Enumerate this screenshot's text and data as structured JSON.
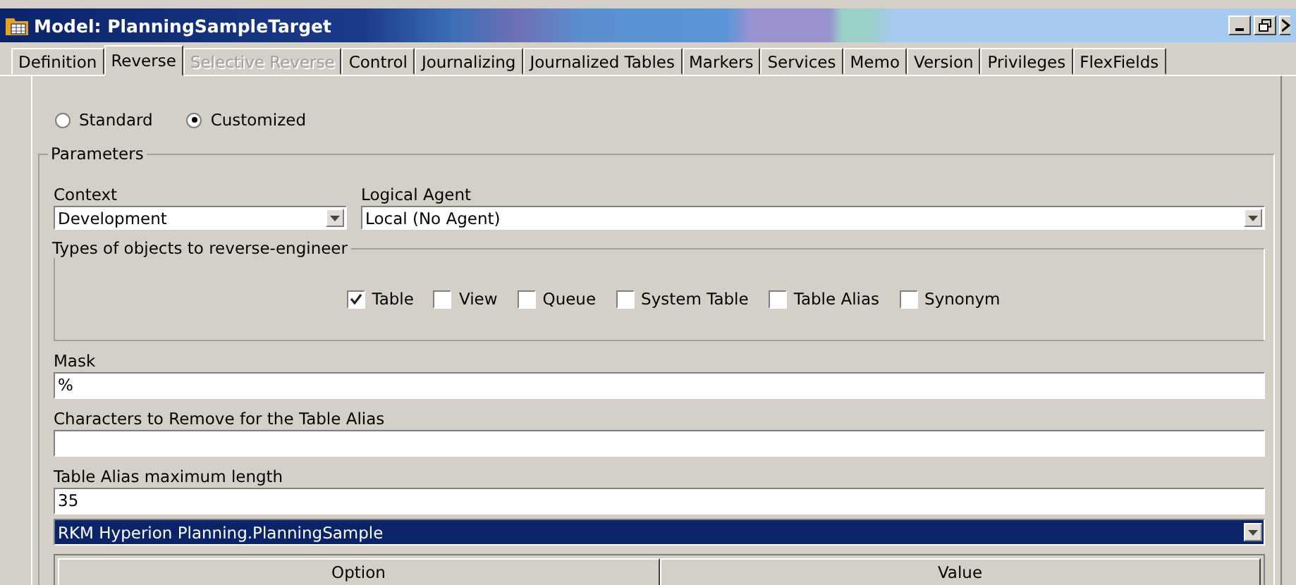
{
  "window": {
    "title": "Model: PlanningSampleTarget"
  },
  "tabs": [
    {
      "label": "Definition",
      "selected": false,
      "disabled": false
    },
    {
      "label": "Reverse",
      "selected": true,
      "disabled": false
    },
    {
      "label": "Selective Reverse",
      "selected": false,
      "disabled": true
    },
    {
      "label": "Control",
      "selected": false,
      "disabled": false
    },
    {
      "label": "Journalizing",
      "selected": false,
      "disabled": false
    },
    {
      "label": "Journalized Tables",
      "selected": false,
      "disabled": false
    },
    {
      "label": "Markers",
      "selected": false,
      "disabled": false
    },
    {
      "label": "Services",
      "selected": false,
      "disabled": false
    },
    {
      "label": "Memo",
      "selected": false,
      "disabled": false
    },
    {
      "label": "Version",
      "selected": false,
      "disabled": false
    },
    {
      "label": "Privileges",
      "selected": false,
      "disabled": false
    },
    {
      "label": "FlexFields",
      "selected": false,
      "disabled": false
    }
  ],
  "mode": [
    {
      "label": "Standard",
      "selected": false
    },
    {
      "label": "Customized",
      "selected": true
    }
  ],
  "parameters": {
    "title": "Parameters",
    "context": {
      "label": "Context",
      "value": "Development"
    },
    "logical_agent": {
      "label": "Logical Agent",
      "value": "Local (No Agent)"
    },
    "types": {
      "title": "Types of objects to reverse-engineer",
      "items": [
        {
          "label": "Table",
          "checked": true
        },
        {
          "label": "View",
          "checked": false
        },
        {
          "label": "Queue",
          "checked": false
        },
        {
          "label": "System Table",
          "checked": false
        },
        {
          "label": "Table Alias",
          "checked": false
        },
        {
          "label": "Synonym",
          "checked": false
        }
      ]
    },
    "mask": {
      "label": "Mask",
      "value": "%"
    },
    "chars_remove": {
      "label": "Characters to Remove for the Table Alias"
    },
    "alias_length": {
      "label": "Table Alias maximum length",
      "value": "35"
    },
    "rkm": {
      "value": "RKM Hyperion Planning.PlanningSample"
    },
    "table": {
      "columns": [
        "Option",
        "Value"
      ]
    }
  }
}
